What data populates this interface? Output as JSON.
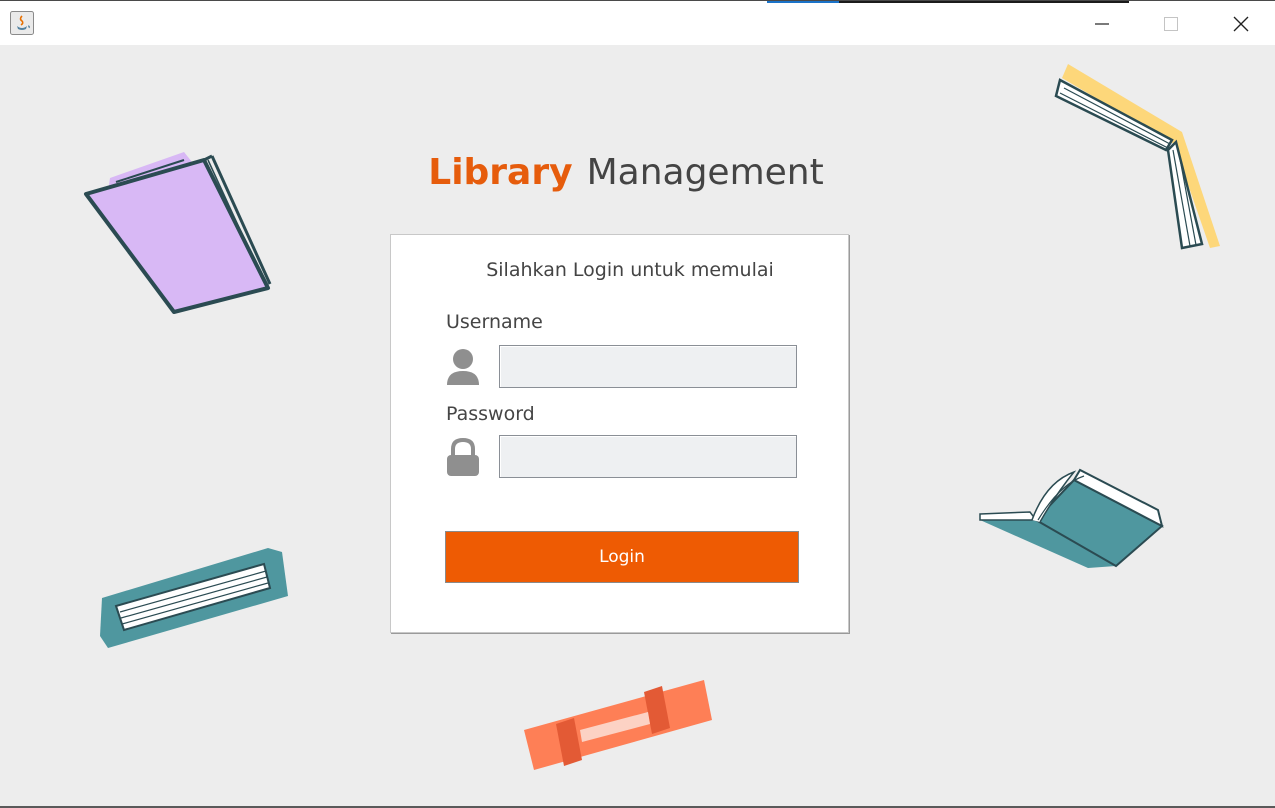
{
  "window": {
    "title": "",
    "app_icon": "java-icon",
    "controls": [
      "minimize-icon",
      "maximize-icon",
      "close-icon"
    ]
  },
  "header": {
    "title_accent": "Library",
    "title_rest": "Management"
  },
  "login": {
    "subtitle": "Silahkan Login untuk memulai",
    "username_label": "Username",
    "username_value": "",
    "username_icon": "user-icon",
    "password_label": "Password",
    "password_value": "",
    "password_icon": "lock-icon",
    "button_label": "Login"
  },
  "colors": {
    "accent": "#ee5b03",
    "background": "#ededed",
    "card": "#ffffff",
    "input_background": "#eef0f2",
    "book_purple": "#d8b8f5",
    "book_teal": "#4f979f",
    "book_yellow": "#fdd77a",
    "book_orange": "#fe7f56"
  },
  "decorations": [
    "purple-book-icon",
    "open-book-icon",
    "teal-book-icon",
    "open-teal-book-icon",
    "orange-book-icon"
  ]
}
